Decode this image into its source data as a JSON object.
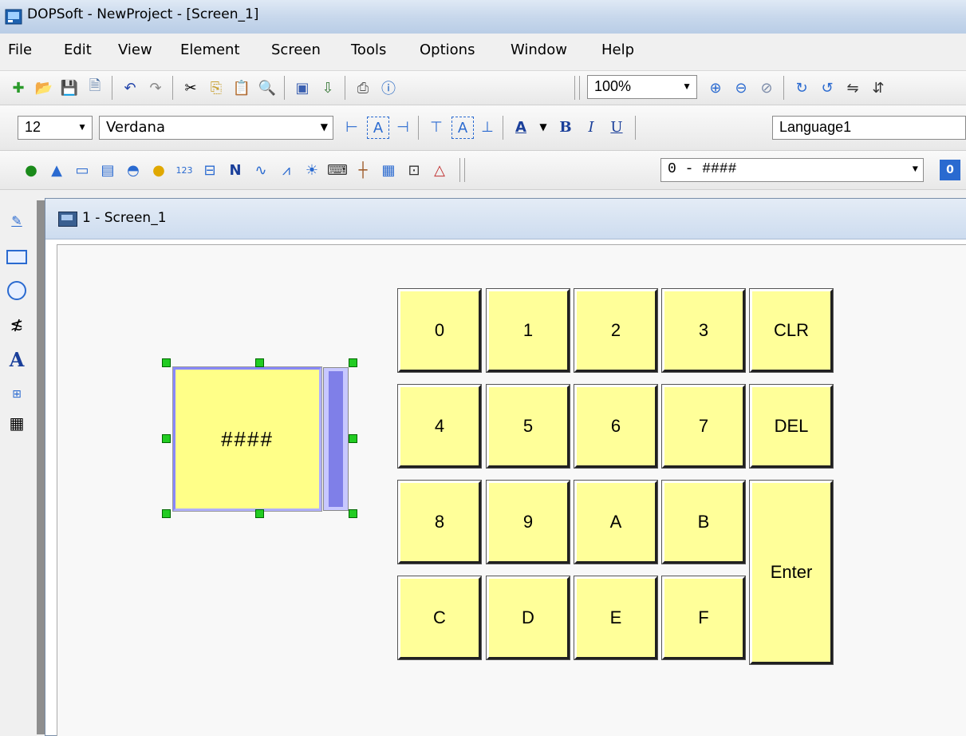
{
  "window": {
    "title": "DOPSoft - NewProject - [Screen_1]"
  },
  "menu": [
    "File",
    "Edit",
    "View",
    "Element",
    "Screen",
    "Tools",
    "Options",
    "Window",
    "Help"
  ],
  "toolbar": {
    "zoom": "100%",
    "font_size": "12",
    "font_name": "Verdana",
    "language": "Language1",
    "format": "0 - ####"
  },
  "child_window": {
    "title": "1 - Screen_1"
  },
  "numeric_input": {
    "text": "####"
  },
  "keypad": {
    "rows": [
      [
        "0",
        "1",
        "2",
        "3",
        "CLR"
      ],
      [
        "4",
        "5",
        "6",
        "7",
        "DEL"
      ],
      [
        "8",
        "9",
        "A",
        "B"
      ],
      [
        "C",
        "D",
        "E",
        "F"
      ]
    ],
    "enter": "Enter"
  },
  "colors": {
    "key_fill": "#ffff99",
    "input_fill": "#ffff88",
    "accent": "#7f7fe8"
  }
}
